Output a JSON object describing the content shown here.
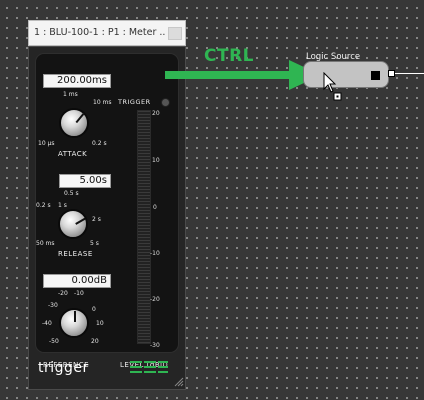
{
  "window": {
    "title": "1 : BLU-100-1 : P1 : Meter ..."
  },
  "module": {
    "attack": {
      "value": "200.00ms",
      "caption": "ATTACK",
      "scale": [
        "1 ms",
        "10 ms",
        "10 µs",
        "0.2 s"
      ]
    },
    "release": {
      "value": "5.00s",
      "caption": "RELEASE",
      "scale": [
        "0.5 s",
        "1 s",
        "0.2 s",
        "2 s",
        "50 ms",
        "5 s"
      ]
    },
    "reference": {
      "value": "0.00dB",
      "caption": "REFERENCE",
      "scale": [
        "-20",
        "-10",
        "-30",
        "0",
        "-40",
        "10",
        "-50",
        "20"
      ]
    },
    "trigger_label": "TRIGGER",
    "level_caption": "LEVEL (dBu)",
    "meter_ticks": [
      "20",
      "10",
      "0",
      "-10",
      "-20",
      "-30"
    ],
    "brand": "trigger"
  },
  "logic_source": {
    "title": "Logic Source"
  },
  "overlay": {
    "ctrl_text": "CTRL"
  },
  "colors": {
    "canvas": "#373737",
    "arrow": "#2fb552",
    "logic_block": "#c3c3c3"
  },
  "icons": [
    "close-icon",
    "knob-icon",
    "bss-logo-icon",
    "resize-grip-icon",
    "cursor-icon",
    "arrow-icon"
  ]
}
